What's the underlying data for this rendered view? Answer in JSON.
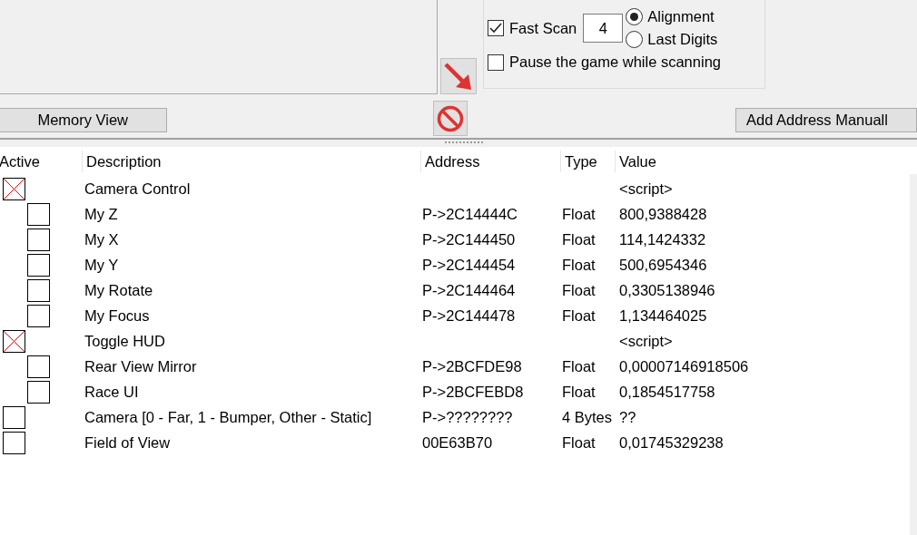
{
  "scan_options": {
    "fast_scan": {
      "label": "Fast Scan",
      "checked": true,
      "value": "4"
    },
    "alignment": [
      {
        "label": "Alignment",
        "selected": true
      },
      {
        "label": "Last Digits",
        "selected": false
      }
    ],
    "pause": {
      "label": "Pause the game while scanning",
      "checked": false
    }
  },
  "buttons": {
    "memory_view": "Memory View",
    "add_address": "Add Address Manuall"
  },
  "table": {
    "columns": [
      "Active",
      "Description",
      "Address",
      "Type",
      "Value"
    ],
    "rows": [
      {
        "kind": "script",
        "description": "Camera Control",
        "value": "<script>",
        "children": [
          {
            "kind": "entry",
            "active": false,
            "description": "My Z",
            "address": "P->2C14444C",
            "type": "Float",
            "value": "800,9388428"
          },
          {
            "kind": "entry",
            "active": false,
            "description": "My X",
            "address": "P->2C144450",
            "type": "Float",
            "value": "114,1424332"
          },
          {
            "kind": "entry",
            "active": false,
            "description": "My Y",
            "address": "P->2C144454",
            "type": "Float",
            "value": "500,6954346"
          },
          {
            "kind": "entry",
            "active": false,
            "description": "My Rotate",
            "address": "P->2C144464",
            "type": "Float",
            "value": "0,3305138946"
          },
          {
            "kind": "entry",
            "active": false,
            "description": "My Focus",
            "address": "P->2C144478",
            "type": "Float",
            "value": "1,134464025"
          }
        ]
      },
      {
        "kind": "script",
        "description": "Toggle HUD",
        "value": "<script>",
        "children": [
          {
            "kind": "entry",
            "active": false,
            "description": "Rear View Mirror",
            "address": "P->2BCFDE98",
            "type": "Float",
            "value": "0,00007146918506"
          },
          {
            "kind": "entry",
            "active": false,
            "description": "Race UI",
            "address": "P->2BCFEBD8",
            "type": "Float",
            "value": "0,1854517758"
          }
        ]
      },
      {
        "kind": "entry",
        "active": false,
        "description": "Camera [0 - Far, 1 - Bumper, Other - Static]",
        "address": "P->????????",
        "type": "4 Bytes",
        "value": "??"
      },
      {
        "kind": "entry",
        "active": false,
        "description": "Field of View",
        "address": "00E63B70",
        "type": "Float",
        "value": "0,01745329238"
      }
    ]
  }
}
